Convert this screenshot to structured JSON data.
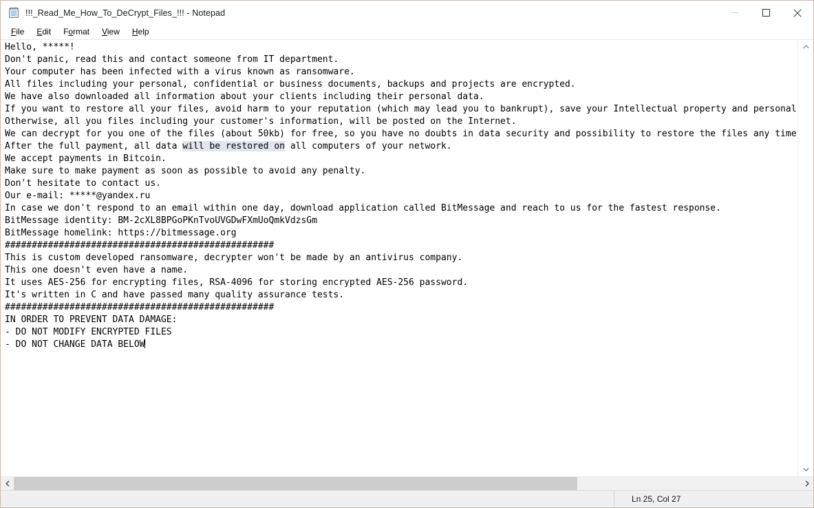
{
  "window": {
    "title": "!!!_Read_Me_How_To_DeCrypt_Files_!!! - Notepad",
    "icon": "notepad-icon",
    "controls": {
      "minimize": "minimize-icon",
      "maximize": "maximize-icon",
      "close": "close-icon"
    }
  },
  "menubar": {
    "items": [
      {
        "label": "File",
        "accesskey": "F"
      },
      {
        "label": "Edit",
        "accesskey": "E"
      },
      {
        "label": "Format",
        "accesskey": "o"
      },
      {
        "label": "View",
        "accesskey": "V"
      },
      {
        "label": "Help",
        "accesskey": "H"
      }
    ]
  },
  "document": {
    "lines": [
      "Hello, *****!",
      "Don't panic, read this and contact someone from IT department.",
      "Your computer has been infected with a virus known as ransomware.",
      "All files including your personal, confidential or business documents, backups and projects are encrypted.",
      "We have also downloaded all information about your clients including their personal data.",
      "If you want to restore all your files, avoid harm to your reputation (which may lead you to bankrupt), save your Intellectual property and personal",
      "Otherwise, all you files including your customer's information, will be posted on the Internet.",
      "We can decrypt for you one of the files (about 50kb) for free, so you have no doubts in data security and possibility to restore the files any time",
      "After the full payment, all data will be restored on all computers of your network.",
      "We accept payments in Bitcoin.",
      "Make sure to make payment as soon as possible to avoid any penalty.",
      "Don't hesitate to contact us.",
      "Our e-mail: *****@yandex.ru",
      "In case we don't respond to an email within one day, download application called BitMessage and reach to us for the fastest response.",
      "BitMessage identity: BM-2cXL8BPGoPKnTvoUVGDwFXmUoQmkVdzsGm",
      "BitMessage homelink: https://bitmessage.org",
      "##################################################",
      "This is custom developed ransomware, decrypter won't be made by an antivirus company.",
      "This one doesn't even have a name.",
      "It uses AES-256 for encrypting files, RSA-4096 for storing encrypted AES-256 password.",
      "It's written in C and have passed many quality assurance tests.",
      "##################################################",
      "IN ORDER TO PREVENT DATA DAMAGE:",
      "- DO NOT MODIFY ENCRYPTED FILES",
      "- DO NOT CHANGE DATA BELOW"
    ],
    "selection": {
      "line_index": 8,
      "before": "After the full payment, all data ",
      "selected": "will be restored on",
      "after": " all computers of your network."
    },
    "caret": {
      "line_index": 24,
      "text": "- DO NOT CHANGE DATA BELOW"
    }
  },
  "scrollbars": {
    "vertical": {
      "up_arrow": "chevron-up-icon",
      "down_arrow": "chevron-down-icon"
    },
    "horizontal": {
      "left_arrow": "chevron-left-icon",
      "right_arrow": "chevron-right-icon"
    }
  },
  "statusbar": {
    "position": "Ln 25, Col 27"
  },
  "colors": {
    "selection": "#dfe6ef",
    "window_border": "#c9b9a8",
    "statusbar_bg": "#f0f0f0",
    "scrollbar_thumb": "#cdcdcd"
  }
}
